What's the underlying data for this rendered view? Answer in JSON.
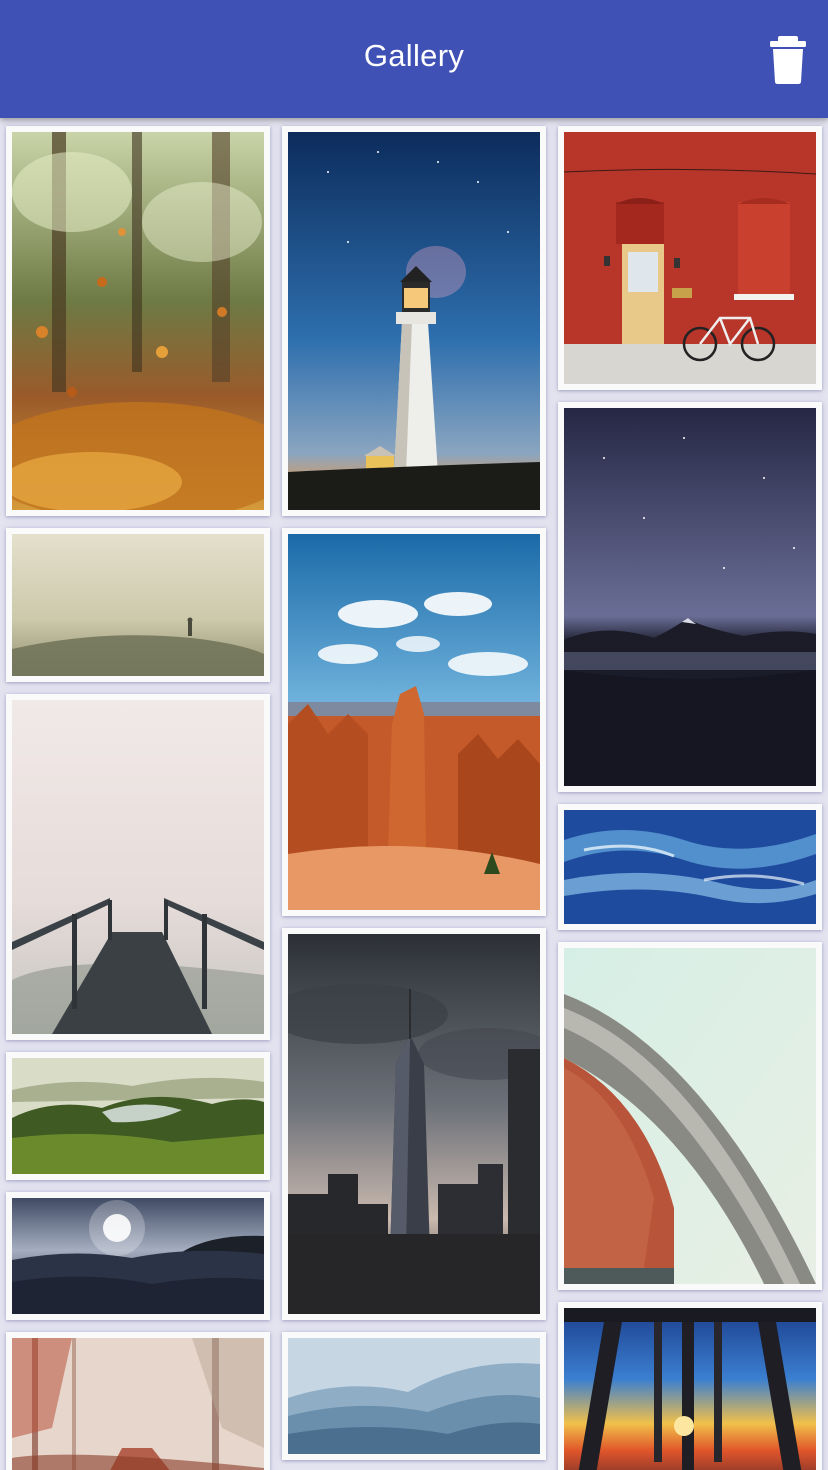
{
  "app_bar": {
    "title": "Gallery",
    "background": "#3f51b5",
    "delete_icon": "trash-icon"
  },
  "gallery": {
    "items": [
      {
        "id": "autumn-leaves",
        "icon": "photo-autumn-leaves"
      },
      {
        "id": "foggy-hill",
        "icon": "photo-foggy-hill"
      },
      {
        "id": "foggy-pier",
        "icon": "photo-foggy-pier"
      },
      {
        "id": "forest-lake",
        "icon": "photo-forest-lake"
      },
      {
        "id": "ocean-sunset",
        "icon": "photo-ocean-sunset"
      },
      {
        "id": "misty-forest",
        "icon": "photo-misty-forest"
      },
      {
        "id": "lighthouse",
        "icon": "photo-lighthouse"
      },
      {
        "id": "canyon",
        "icon": "photo-canyon"
      },
      {
        "id": "skyscraper",
        "icon": "photo-skyscraper"
      },
      {
        "id": "blue-mountains",
        "icon": "photo-blue-mountains"
      },
      {
        "id": "red-building-bicycle",
        "icon": "photo-red-building"
      },
      {
        "id": "night-lake-mountain",
        "icon": "photo-night-lake"
      },
      {
        "id": "blue-waves",
        "icon": "photo-blue-waves"
      },
      {
        "id": "curved-building",
        "icon": "photo-curved-building"
      },
      {
        "id": "pier-sunset",
        "icon": "photo-pier-sunset"
      }
    ]
  }
}
